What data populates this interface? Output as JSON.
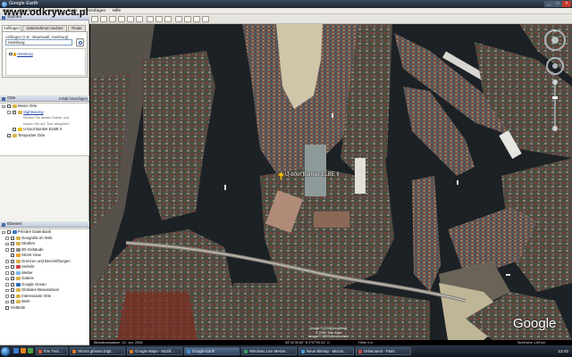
{
  "window": {
    "title": "Google Earth"
  },
  "watermark": "www.odkrywca.pl",
  "menu": [
    "Datei",
    "Bearbeiten",
    "Ansicht",
    "Tools",
    "Hinzufügen",
    "Hilfe"
  ],
  "search_panel": {
    "header": "Suchen",
    "tabs": [
      "Anfliegen",
      "Unternehmen suchen",
      "Route"
    ],
    "label": "Anfliegen (z.B.: Baumwall, Hamburg)",
    "query": "Hamburg",
    "results": [
      "Hamburg"
    ]
  },
  "places_panel": {
    "header": "Orte",
    "add_label": "Inhalt hinzufügen",
    "items": [
      {
        "label": "Meine Orte",
        "level": 0
      },
      {
        "label": "Sightseeing",
        "level": 1,
        "link": true
      },
      {
        "label": "Klicken Sie dieses Ordner und",
        "level": 2,
        "note": true
      },
      {
        "label": "klicken Sie auf 'Tour abspielen'",
        "level": 2,
        "note": true
      },
      {
        "label": "U-boot Bunker ELBE II",
        "level": 1
      },
      {
        "label": "Temporäre Orte",
        "level": 0
      }
    ]
  },
  "layers_panel": {
    "header": "Ebenen",
    "items": [
      "Primäre Datenbank",
      "Geografie im Web",
      "Straßen",
      "3D-Gebäude",
      "Street View",
      "Grenzen und Beschriftungen",
      "Verkehr",
      "Wetter",
      "Galerie",
      "Google Ocean",
      "Globales Bewusstsein",
      "Interessante Orte",
      "Mehr",
      "Gelände"
    ]
  },
  "map": {
    "placemark_label": "U-boot Bunker ELBE II",
    "logo": "Google",
    "copyright_lines": [
      "Image © 2009 AeroWest",
      "© 2009 Tele Atlas",
      "Image © 2009 GeoContent"
    ],
    "status": {
      "imagery_date": "Bilddatumsdatum: 10. Jun. 2006",
      "coords": "53°32'30.80\" N  9°57'09.51\" O",
      "elev": "Höhe   0 m",
      "eye": "Sichthöhe  1.69 km"
    }
  },
  "taskbar": {
    "tasks": [
      {
        "label": "Ihre Tool...",
        "color": "#e05a2a"
      },
      {
        "label": "Strona główna Digit...",
        "color": "#e07a20"
      },
      {
        "label": "Google Maps - Mozill...",
        "color": "#e07a20"
      },
      {
        "label": "Google Earth",
        "color": "#3d8fe0",
        "active": true
      },
      {
        "label": "Windows Live Messe...",
        "color": "#38a060"
      },
      {
        "label": "Neue Bitmap - Micros...",
        "color": "#4aa0d8"
      },
      {
        "label": "Unbenannt - Paint",
        "color": "#c44"
      }
    ],
    "time": "13:42"
  },
  "colors": {
    "water": "#1c2125",
    "land": "#5a5349",
    "accent": "#3d8fe0"
  }
}
